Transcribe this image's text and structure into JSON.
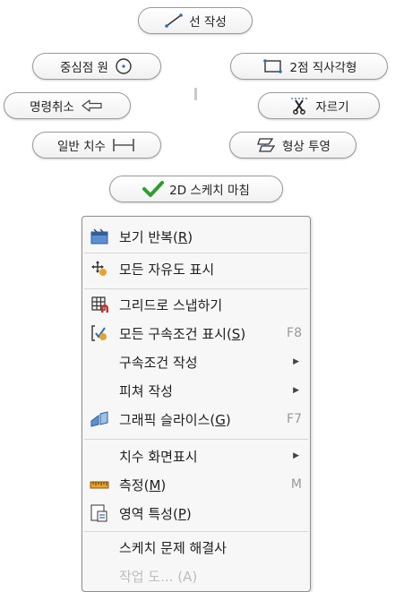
{
  "marking_menu": {
    "create_line": "선 작성",
    "center_circle": "중심점 원",
    "two_point_rect": "2점 직사각형",
    "cancel": "명령취소",
    "trim": "자르기",
    "general_dimension": "일반 치수",
    "project_geometry": "형상 투영",
    "finish_sketch": "2D 스케치 마침"
  },
  "context_menu": {
    "items": [
      {
        "label": "보기 반복",
        "mnemonic": "R",
        "icon": "repeat-view-icon"
      },
      {
        "label": "모든 자유도 표시",
        "icon": "dof-icon"
      },
      {
        "label": "그리드로 스냅하기",
        "icon": "grid-snap-icon"
      },
      {
        "label": "모든 구속조건 표시",
        "mnemonic": "S",
        "shortcut": "F8",
        "icon": "constraint-icon"
      },
      {
        "label": "구속조건 작성",
        "submenu": true
      },
      {
        "label": "피쳐 작성",
        "submenu": true
      },
      {
        "label": "그래픽 슬라이스",
        "mnemonic": "G",
        "shortcut": "F7",
        "icon": "slice-icon"
      },
      {
        "label": "치수 화면표시",
        "submenu": true
      },
      {
        "label": "측정",
        "mnemonic": "M",
        "shortcut": "M",
        "icon": "measure-icon"
      },
      {
        "label": "영역 특성",
        "mnemonic": "P",
        "icon": "region-icon"
      },
      {
        "label": "스케치 문제 해결사"
      },
      {
        "label": "작업 도... (A)",
        "disabled": true
      }
    ]
  },
  "colors": {
    "check": "#2e9e2e",
    "accent_blue": "#2f6db5",
    "accent_orange": "#e6a22e"
  }
}
